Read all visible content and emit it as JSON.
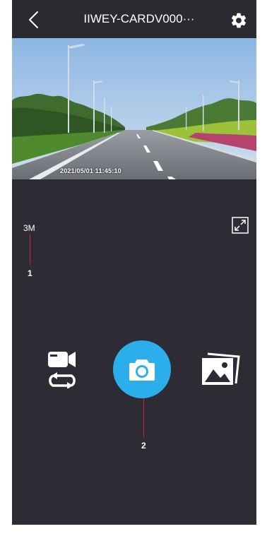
{
  "header": {
    "title": "IIWEY-CARDV000···",
    "back_icon": "chevron-left-icon",
    "settings_icon": "gear-icon"
  },
  "preview": {
    "timestamp": "2021/05/01  11:45:10"
  },
  "controls": {
    "resolution": "3M",
    "fullscreen_icon": "expand-icon",
    "mode_icon": "video-loop-icon",
    "shutter_icon": "camera-icon",
    "gallery_icon": "gallery-icon"
  },
  "callouts": [
    {
      "number": "1"
    },
    {
      "number": "2"
    }
  ],
  "colors": {
    "background": "#2d2c35",
    "topbar": "#2a2a31",
    "accent": "#2baee9",
    "callout_line": "#d8202a"
  }
}
